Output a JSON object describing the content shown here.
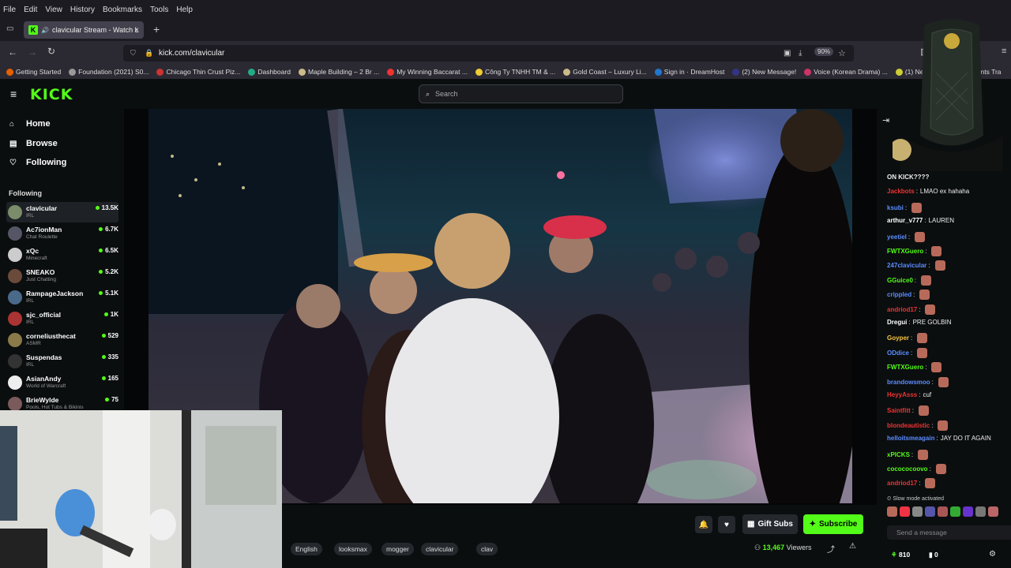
{
  "browser": {
    "menu": [
      "File",
      "Edit",
      "View",
      "History",
      "Bookmarks",
      "Tools",
      "Help"
    ],
    "tab_title": "clavicular Stream - Watch L",
    "url": "kick.com/clavicular",
    "zoom": "90%",
    "bookmarks": [
      {
        "label": "Getting Started",
        "color": "#e66000"
      },
      {
        "label": "Foundation (2021) S0...",
        "color": "#999"
      },
      {
        "label": "Chicago Thin Crust Piz...",
        "color": "#c33"
      },
      {
        "label": "Dashboard",
        "color": "#2a8"
      },
      {
        "label": "Maple Building – 2 Br ...",
        "color": "#cb8"
      },
      {
        "label": "My Winning Baccarat ...",
        "color": "#e33"
      },
      {
        "label": "Công Ty TNHH TM & ...",
        "color": "#ec3"
      },
      {
        "label": "Gold Coast – Luxury Li...",
        "color": "#cb8"
      },
      {
        "label": "Sign in · DreamHost",
        "color": "#27c"
      },
      {
        "label": "(2) New Message!",
        "color": "#338"
      },
      {
        "label": "Voice (Korean Drama) ...",
        "color": "#c36"
      },
      {
        "label": "(1) New Message!",
        "color": "#cc3"
      },
      {
        "label": "ents Tra",
        "color": "#888"
      }
    ]
  },
  "kick": {
    "logo": "KICK",
    "search_placeholder": "Search",
    "nav": [
      {
        "label": "Home",
        "icon": "⌂"
      },
      {
        "label": "Browse",
        "icon": "▤"
      },
      {
        "label": "Following",
        "icon": "♡"
      }
    ],
    "following_header": "Following",
    "following": [
      {
        "name": "clavicular",
        "category": "IRL",
        "viewers": "13.5K",
        "color": "#7a8c6a"
      },
      {
        "name": "Ac7ionMan",
        "category": "Chat Roulette",
        "viewers": "6.7K",
        "color": "#556"
      },
      {
        "name": "xQc",
        "category": "Minecraft",
        "viewers": "6.5K",
        "color": "#ccc"
      },
      {
        "name": "SNEAKO",
        "category": "Just Chatting",
        "viewers": "5.2K",
        "color": "#6a4a3a"
      },
      {
        "name": "RampageJackson",
        "category": "IRL",
        "viewers": "5.1K",
        "color": "#4a6a8a"
      },
      {
        "name": "sjc_official",
        "category": "IRL",
        "viewers": "1K",
        "color": "#a33"
      },
      {
        "name": "corneliusthecat",
        "category": "ASMR",
        "viewers": "529",
        "color": "#8a7a4a"
      },
      {
        "name": "Suspendas",
        "category": "IRL",
        "viewers": "335",
        "color": "#333"
      },
      {
        "name": "AsianAndy",
        "category": "World of Warcraft",
        "viewers": "165",
        "color": "#eee"
      },
      {
        "name": "BrieWylde",
        "category": "Pools, Hot Tubs & Bikinis",
        "viewers": "75",
        "color": "#7a5a5a"
      }
    ]
  },
  "stream": {
    "tags": [
      "English",
      "looksmax",
      "mogger",
      "clavicular",
      "clav"
    ],
    "gift_label": "Gift Subs",
    "subscribe_label": "Subscribe",
    "viewers_count": "13,467",
    "viewers_label": "Viewers"
  },
  "chat": {
    "messages": [
      {
        "user": "",
        "text": "ON KICK????",
        "color": "#fff"
      },
      {
        "user": "Jackbots",
        "text": "LMAO ex hahaha",
        "color": "#e33"
      },
      {
        "user": "ksubi",
        "text": "",
        "color": "#5b8cff"
      },
      {
        "user": "arthur_v777",
        "text": "LAUREN",
        "color": "#fff"
      },
      {
        "user": "yeetiel",
        "text": "",
        "color": "#5b8cff"
      },
      {
        "user": "FWTXGuero",
        "text": "",
        "color": "#53fc18"
      },
      {
        "user": "247clavicular",
        "text": "",
        "color": "#5b8cff"
      },
      {
        "user": "GGuice0",
        "text": "",
        "color": "#53fc18"
      },
      {
        "user": "crippled",
        "text": "",
        "color": "#5b8cff"
      },
      {
        "user": "andriod17",
        "text": "",
        "color": "#e33"
      },
      {
        "user": "Dregui",
        "text": "PRE GOLBIN",
        "color": "#fff"
      },
      {
        "user": "Goyper",
        "text": "",
        "color": "#f5c542"
      },
      {
        "user": "ODdice",
        "text": "",
        "color": "#5b8cff"
      },
      {
        "user": "FWTXGuero",
        "text": "",
        "color": "#53fc18"
      },
      {
        "user": "brandowsmoo",
        "text": "",
        "color": "#5b8cff"
      },
      {
        "user": "HeyyAsss",
        "text": "cuf",
        "color": "#e33"
      },
      {
        "user": "Saintfitt",
        "text": "",
        "color": "#e33"
      },
      {
        "user": "blondeautistic",
        "text": "",
        "color": "#e33"
      },
      {
        "user": "helloitsmeagain",
        "text": "JAY DO IT AGAIN",
        "color": "#5b8cff"
      },
      {
        "user": "xPICKS",
        "text": "",
        "color": "#53fc18"
      },
      {
        "user": "cocococoovo",
        "text": "",
        "color": "#53fc18"
      },
      {
        "user": "andriod17",
        "text": "",
        "color": "#e33"
      }
    ],
    "slow_mode": "Slow mode activated",
    "input_placeholder": "Send a message",
    "points": "810",
    "zero": "0"
  }
}
